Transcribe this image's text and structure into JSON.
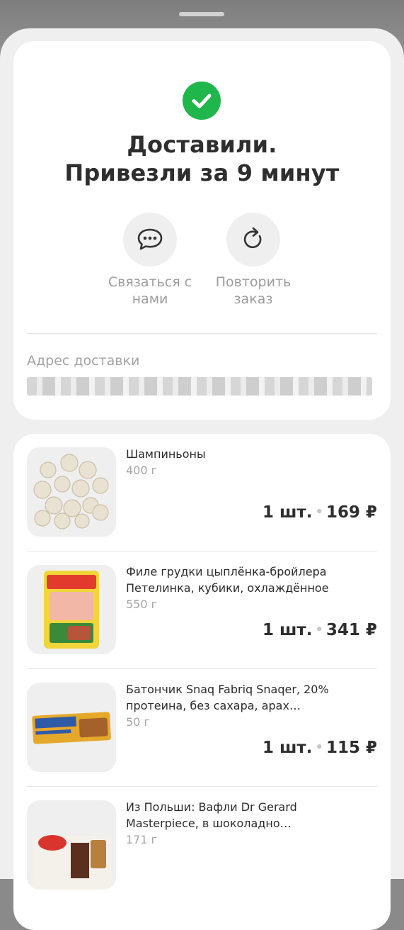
{
  "status": {
    "title_line1": "Доставили.",
    "title_line2": "Привезли за 9 минут",
    "status_color": "#1fb64c"
  },
  "actions": [
    {
      "label": "Связаться с нами",
      "icon": "chat-bubble-icon"
    },
    {
      "label": "Повторить заказ",
      "icon": "repeat-icon"
    }
  ],
  "address": {
    "label": "Адрес доставки",
    "value": "",
    "redacted": true
  },
  "items": [
    {
      "name": "Шампиньоны",
      "weight": "400 г",
      "qty": "1 шт.",
      "price": "169 ₽",
      "image": "mushrooms-image"
    },
    {
      "name": "Филе грудки цыплёнка-бройлера Петелинка, кубики, охлаждённое",
      "weight": "550 г",
      "qty": "1 шт.",
      "price": "341 ₽",
      "image": "chicken-pack-image"
    },
    {
      "name": "Батончик Snaq Fabriq Snaqer, 20% протеина, без сахара, арах…",
      "weight": "50 г",
      "qty": "1 шт.",
      "price": "115 ₽",
      "image": "snack-bar-image"
    },
    {
      "name": "Из Польши: Вафли Dr Gerard Masterpiece, в шоколадно…",
      "weight": "171 г",
      "qty": "",
      "price": "",
      "image": "wafers-image"
    }
  ]
}
